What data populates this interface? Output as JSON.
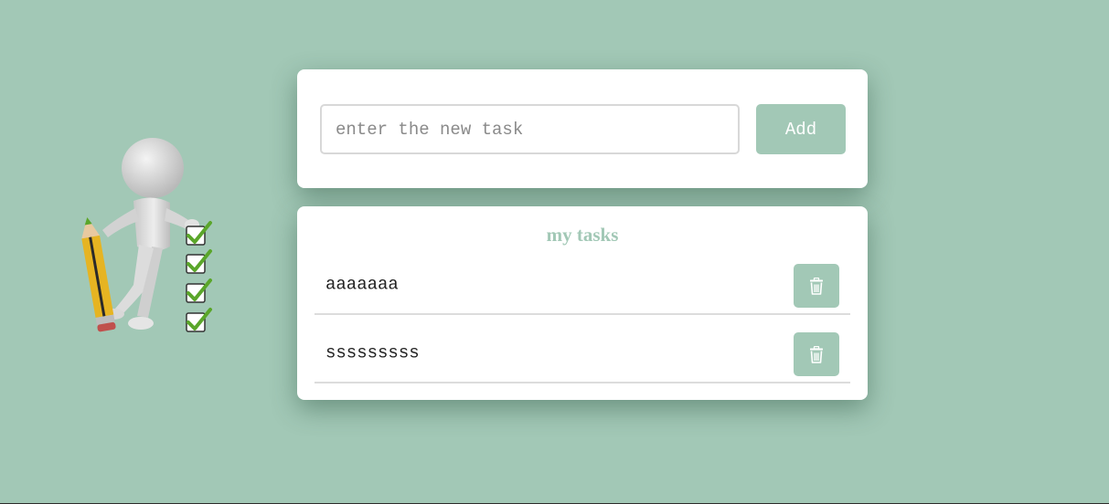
{
  "add_form": {
    "placeholder": "enter the new task",
    "value": "",
    "add_label": "Add"
  },
  "tasks": {
    "title": "my tasks",
    "items": [
      {
        "text": "aaaaaaa"
      },
      {
        "text": "sssssssss"
      }
    ]
  },
  "icons": {
    "delete": "trash-icon",
    "illustration": "person-with-pencil-checklist-illustration"
  },
  "colors": {
    "background": "#a2c8b6",
    "accent": "#a2c8b6",
    "card": "#ffffff",
    "checkmark": "#5aa62a",
    "pencil": "#e6b422"
  }
}
